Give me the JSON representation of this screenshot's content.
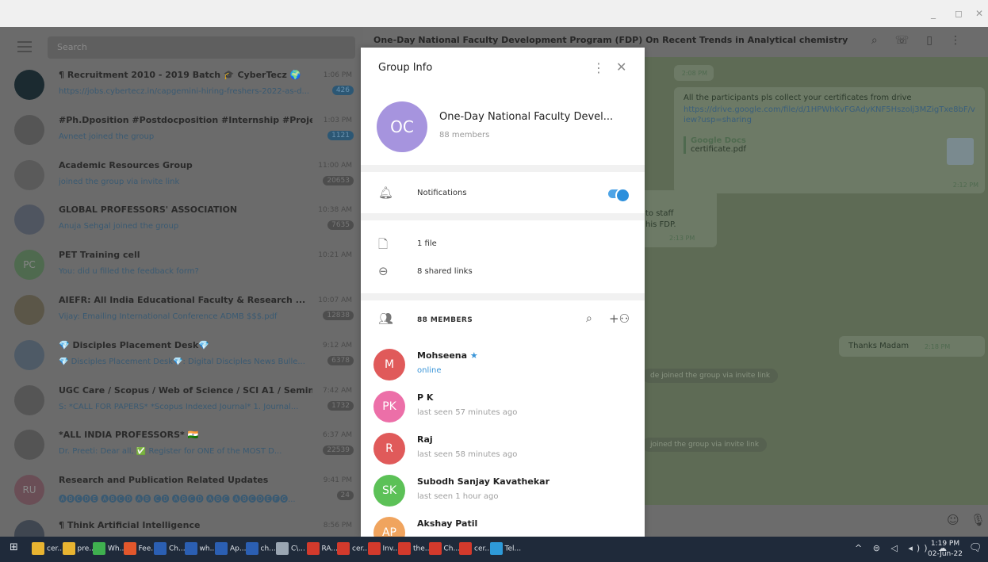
{
  "window": {
    "controls": [
      "_",
      "◻",
      "✕"
    ]
  },
  "sidebar": {
    "search_placeholder": "Search",
    "chats": [
      {
        "avatar_text": "",
        "avatar_color": "#1b2a30",
        "name": "¶ Recruitment 2010 - 2019 Batch 🎓 CyberTecz 🌍",
        "preview": "https://jobs.cybertecz.in/capgemini-hiring-freshers-2022-as-d...",
        "time": "1:06 PM",
        "badge": "426",
        "badge_style": "blue"
      },
      {
        "avatar_text": "",
        "avatar_color": "#555555",
        "name": "#Ph.Dposition #Postdocposition #Internship #Projec...",
        "preview": "Avneet joined the group",
        "time": "1:03 PM",
        "badge": "1121",
        "badge_style": "blue"
      },
      {
        "avatar_text": "",
        "avatar_color": "#5a5a5a",
        "name": "Academic Resources Group",
        "preview": "joined the group via invite link",
        "time": "11:00 AM",
        "badge": "20653",
        "badge_style": "grey"
      },
      {
        "avatar_text": "",
        "avatar_color": "#4f5560",
        "name": "GLOBAL PROFESSORS' ASSOCIATION",
        "preview": "Anuja Sehgal joined the group",
        "time": "10:38 AM",
        "badge": "7635",
        "badge_style": "grey"
      },
      {
        "avatar_text": "PC",
        "avatar_color": "#4f6a4f",
        "name": "PET Training cell",
        "preview": "You: did u filled the feedback form?",
        "time": "10:21 AM",
        "badge": "",
        "badge_style": "none"
      },
      {
        "avatar_text": "",
        "avatar_color": "#5b5648",
        "name": "AIEFR: All India Educational Faculty & Research ...",
        "preview": "Vijay: Emailing International Conference ADMB $$$.pdf",
        "time": "10:07 AM",
        "badge": "12838",
        "badge_style": "grey"
      },
      {
        "avatar_text": "",
        "avatar_color": "#4e5a66",
        "name": "💎 Disciples Placement Desk💎",
        "preview": "💎 Disciples Placement Desk💎: Digital Disciples News Bulle...",
        "time": "9:12 AM",
        "badge": "6378",
        "badge_style": "grey"
      },
      {
        "avatar_text": "",
        "avatar_color": "#555555",
        "name": "UGC Care / Scopus / Web of Science / SCI A1 / Semina...",
        "preview": "S: *CALL FOR PAPERS* *Scopus Indexed Journal* 1. Journal...",
        "time": "7:42 AM",
        "badge": "1732",
        "badge_style": "grey"
      },
      {
        "avatar_text": "",
        "avatar_color": "#545454",
        "name": "*ALL INDIA PROFESSORS* 🇮🇳",
        "preview": "Dr. Preeti: Dear all, ✅ Register for ONE of the MOST D...",
        "time": "6:37 AM",
        "badge": "22539",
        "badge_style": "grey"
      },
      {
        "avatar_text": "RU",
        "avatar_color": "#6a4e56",
        "name": "Research and Publication Related Updates",
        "preview": "🅐🅑🅒🅓🅔 🅐🅑🅒🅓 🅐🅑 🅒🅓 🅐🅑🅒🅓 🅐🅑🅒 🅐🅑🅒🅓🅔🅕🅖...",
        "time": "9:41 PM",
        "badge": "24",
        "badge_style": "grey"
      },
      {
        "avatar_text": "",
        "avatar_color": "#3f4650",
        "name": "¶ Think Artificial Intelligence",
        "preview": "",
        "time": "8:56 PM",
        "badge": "",
        "badge_style": "none"
      }
    ]
  },
  "chat": {
    "title": "One-Day National Faculty Development Program (FDP) On Recent Trends in Analytical chemistry",
    "header_icons": [
      "search-icon",
      "call-icon",
      "sidebar-icon",
      "more-icon"
    ],
    "msg1": {
      "text": "All the participants pls collect your certificates from drive",
      "link": "https://drive.google.com/file/d/1HPWhKvFGAdyKNF5Hszolj3MZigTxe8bF/view?usp=sharing",
      "doc_source": "Google Docs",
      "doc_name": "certificate.pdf",
      "time": "2:12 PM"
    },
    "time_top": "2:08 PM",
    "msg2": {
      "line1": "to staff",
      "line2": "his FDP.",
      "time": "2:13 PM"
    },
    "msg3": {
      "text": "Thanks Madam",
      "time": "2:18 PM"
    },
    "sys1": "de joined the group via invite link",
    "sys2": "joined the group via invite link"
  },
  "group_info": {
    "title": "Group Info",
    "avatar_text": "OC",
    "name": "One-Day National Faculty Devel...",
    "members_count": "88 members",
    "notifications_label": "Notifications",
    "notifications_on": true,
    "files_label": "1 file",
    "links_label": "8 shared links",
    "members_header": "88 MEMBERS",
    "members": [
      {
        "initial": "M",
        "color": "#e05a5a",
        "name": "Mohseena",
        "status": "online",
        "online": true,
        "star": true
      },
      {
        "initial": "PK",
        "color": "#ec6fa8",
        "name": "P K",
        "status": "last seen 57 minutes ago",
        "online": false,
        "star": false
      },
      {
        "initial": "R",
        "color": "#e05a5a",
        "name": "Raj",
        "status": "last seen 58 minutes ago",
        "online": false,
        "star": false
      },
      {
        "initial": "SK",
        "color": "#5cc157",
        "name": "Subodh Sanjay Kavathekar",
        "status": "last seen 1 hour ago",
        "online": false,
        "star": false
      },
      {
        "initial": "AP",
        "color": "#f0a45e",
        "name": "Akshay Patil",
        "status": "",
        "online": false,
        "star": false
      }
    ]
  },
  "taskbar": {
    "items": [
      {
        "label": "cer...",
        "color": "#e8b431"
      },
      {
        "label": "pre...",
        "color": "#e8b431"
      },
      {
        "label": "Wh...",
        "color": "#3fb04f"
      },
      {
        "label": "Fee...",
        "color": "#e2572c"
      },
      {
        "label": "Ch...",
        "color": "#2b5fb3"
      },
      {
        "label": "wh...",
        "color": "#2b5fb3"
      },
      {
        "label": "Ap...",
        "color": "#2b5fb3"
      },
      {
        "label": "ch...",
        "color": "#2b5fb3"
      },
      {
        "label": "C\\...",
        "color": "#9aa6b3"
      },
      {
        "label": "RA...",
        "color": "#d33a2c"
      },
      {
        "label": "cer...",
        "color": "#d33a2c"
      },
      {
        "label": "Inv...",
        "color": "#d33a2c"
      },
      {
        "label": "the...",
        "color": "#d33a2c"
      },
      {
        "label": "Ch...",
        "color": "#d33a2c"
      },
      {
        "label": "cer...",
        "color": "#d33a2c"
      },
      {
        "label": "Tel...",
        "color": "#2e9ad8"
      }
    ],
    "time": "1:19 PM",
    "date": "02-Jun-22",
    "tray": "^ ⊜ ◁ ◂)) ☁"
  }
}
